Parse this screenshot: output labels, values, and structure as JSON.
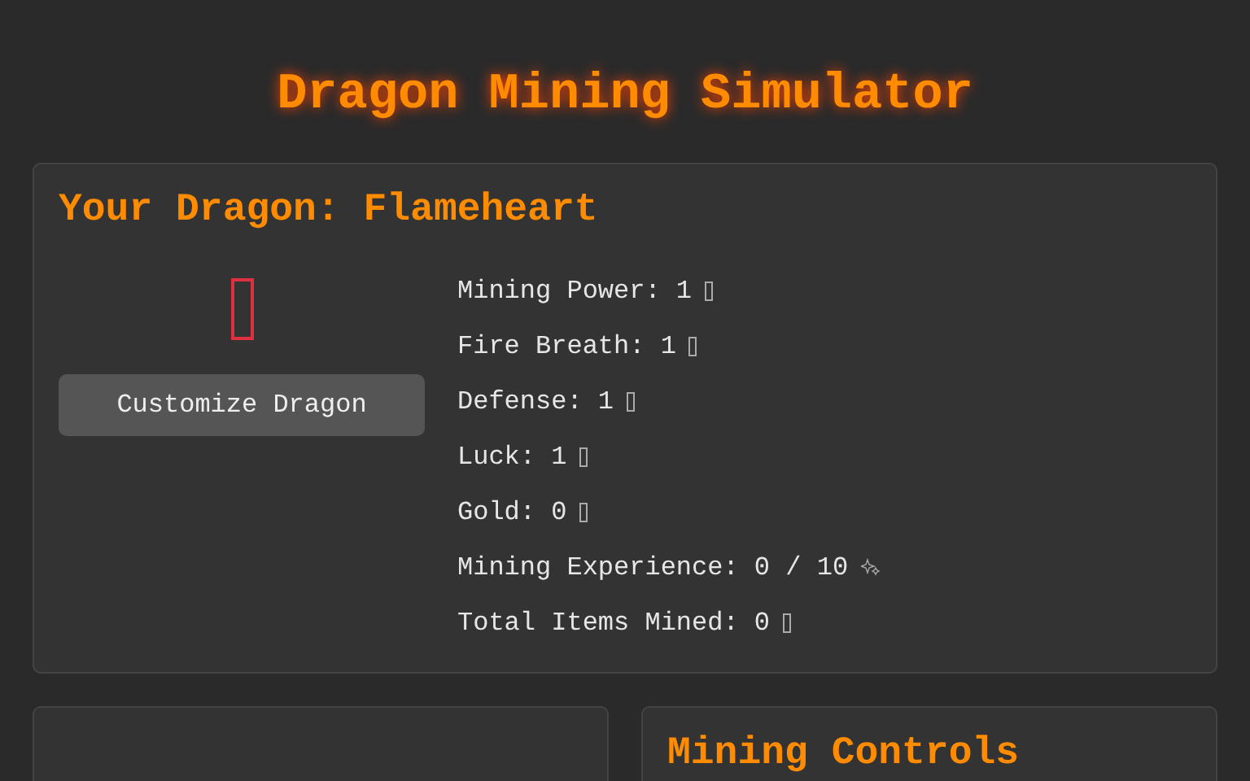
{
  "title": "Dragon Mining Simulator",
  "dragon_panel": {
    "heading": "Your Dragon: Flameheart",
    "customize_button": "Customize Dragon",
    "stats": [
      {
        "text": "Mining Power: 1",
        "kind": "box"
      },
      {
        "text": "Fire Breath: 1",
        "kind": "box"
      },
      {
        "text": "Defense: 1",
        "kind": "box"
      },
      {
        "text": "Luck: 1",
        "kind": "box"
      },
      {
        "text": "Gold: 0",
        "kind": "box"
      },
      {
        "text": "Mining Experience: 0 / 10",
        "kind": "sparkle"
      },
      {
        "text": "Total Items Mined: 0",
        "kind": "box"
      }
    ]
  },
  "controls_panel": {
    "heading": "Mining Controls"
  }
}
